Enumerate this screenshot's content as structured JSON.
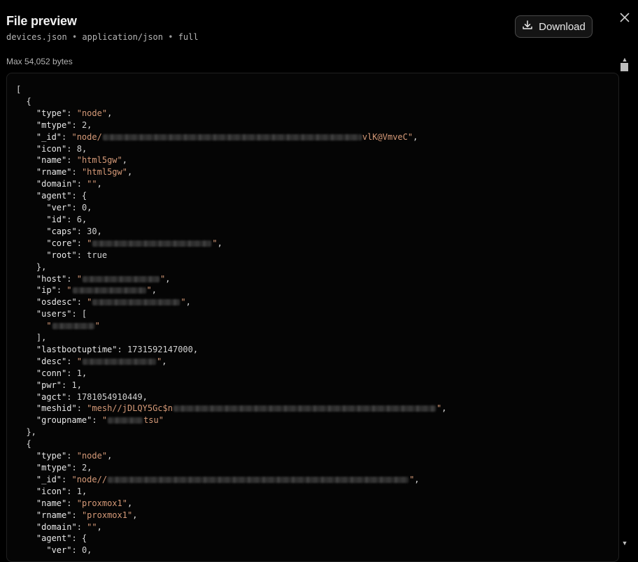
{
  "dialog": {
    "title": "File preview",
    "file_name": "devices.json",
    "mime_type": "application/json",
    "mode": "full",
    "separator": "•",
    "download_label": "Download",
    "max_label": "Max 54,052 bytes"
  },
  "icons": {
    "download": "download-icon",
    "close": "close-icon"
  },
  "code": {
    "node1_id_tail": "vlK@VmveC",
    "node1_name": "html5gw",
    "node1_rname": "html5gw",
    "node1_lastbootuptime": "1731592147000",
    "node1_agct": "1781054910449",
    "node1_meshid_visible": "mesh//jDLQY5Gc$n",
    "node1_groupname_tail": "tsu",
    "node2_name": "proxmox1",
    "node2_rname": "proxmox1"
  }
}
